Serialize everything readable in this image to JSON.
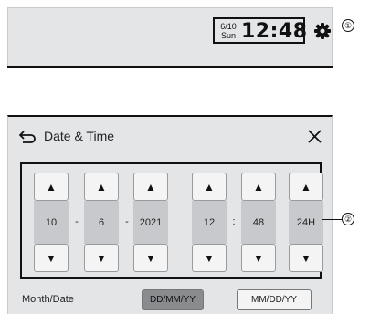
{
  "status": {
    "date_top": "6/10",
    "date_bottom": "Sun",
    "time": "12:48"
  },
  "callouts": {
    "first": "①",
    "second": "②"
  },
  "panel": {
    "title": "Date & Time",
    "month_date_label": "Month/Date",
    "format_options": [
      "DD/MM/YY",
      "MM/DD/YY"
    ],
    "selected_format": "DD/MM/YY"
  },
  "picker": {
    "day": "10",
    "month": "6",
    "year": "2021",
    "hour": "12",
    "minute": "48",
    "clock_mode": "24H",
    "sep_date": "-",
    "sep_time": ":",
    "up_glyph": "▲",
    "down_glyph": "▼"
  },
  "icons": {
    "gear": "gear-icon",
    "back": "back-arrow-icon",
    "close": "close-icon"
  }
}
